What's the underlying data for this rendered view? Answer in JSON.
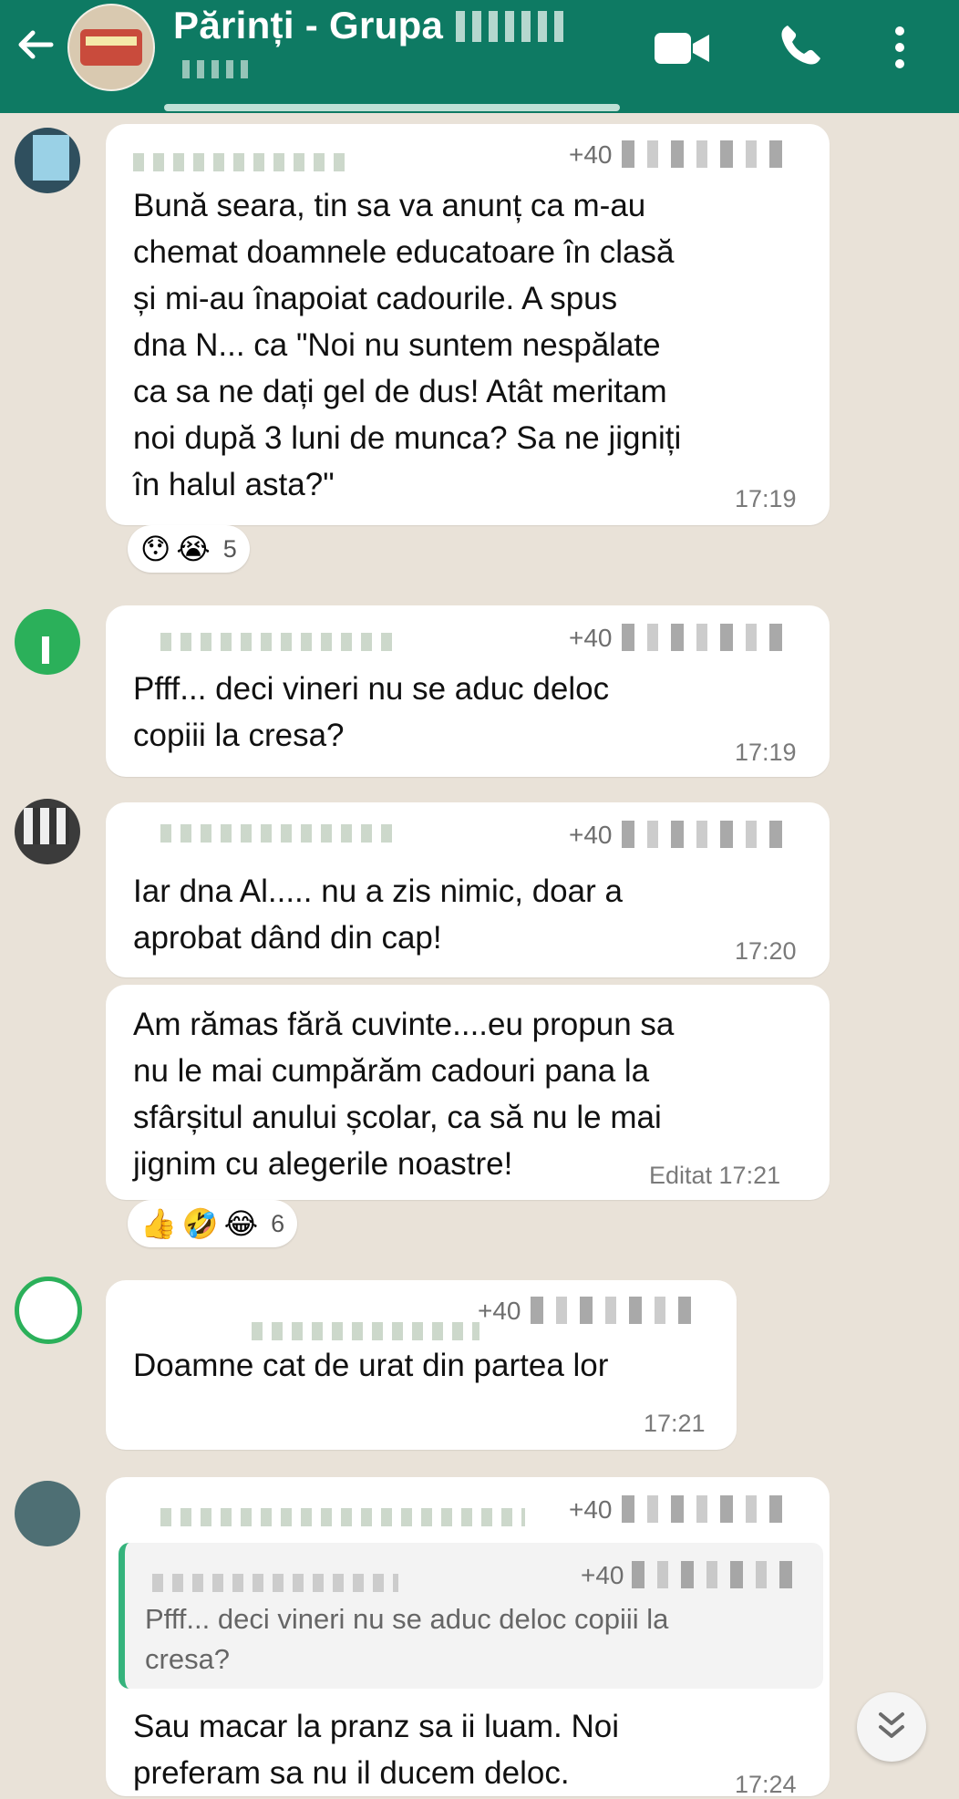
{
  "header": {
    "title": "Părinți - Grupa",
    "colors": {
      "bar": "#0e7a63",
      "chat_bg": "#e9e2d8",
      "accent": "#35b37c"
    },
    "icons": [
      "back-arrow-icon",
      "video-call-icon",
      "phone-call-icon",
      "more-options-icon"
    ]
  },
  "messages": [
    {
      "phone": "+40",
      "text": "Bună seara, tin sa va anunț ca m-au\nchemat doamnele educatoare în clasă\nși mi-au înapoiat cadourile. A spus\ndna N... ca \"Noi nu suntem nespălate\nca sa ne dați gel de dus! Atât meritam\nnoi după 3 luni de munca? Sa ne jigniți\nîn halul asta?\"",
      "time": "17:19",
      "reactions": {
        "emojis": [
          "😯",
          "😭"
        ],
        "count": "5"
      }
    },
    {
      "phone": "+40",
      "sender_fragment": "40",
      "text": "Pfff... deci vineri nu se aduc deloc\ncopiii la cresa?",
      "time": "17:19"
    },
    {
      "phone": "+40",
      "text": "Iar dna Al..... nu a zis nimic, doar a\naprobat dând din cap!",
      "time": "17:20"
    },
    {
      "text": "Am rămas fără cuvinte....eu propun sa\nnu le mai cumpărăm cadouri pana la\nsfârșitul anului școlar, ca să nu le mai\njignim cu alegerile noastre!",
      "time": "Editat 17:21",
      "reactions": {
        "emojis": [
          "👍",
          "🤣",
          "😂"
        ],
        "count": "6"
      }
    },
    {
      "phone": "+40",
      "text": "Doamne cat de urat din partea lor",
      "time": "17:21"
    },
    {
      "phone": "+40",
      "quote": {
        "phone": "+40",
        "text": "Pfff... deci vineri nu se aduc deloc copiii la\ncresa?"
      },
      "text": "Sau macar la pranz sa ii luam. Noi\npreferam sa nu il ducem deloc.",
      "time": "17:24"
    }
  ],
  "scroll_button": {
    "icon": "double-chevron-down-icon"
  }
}
